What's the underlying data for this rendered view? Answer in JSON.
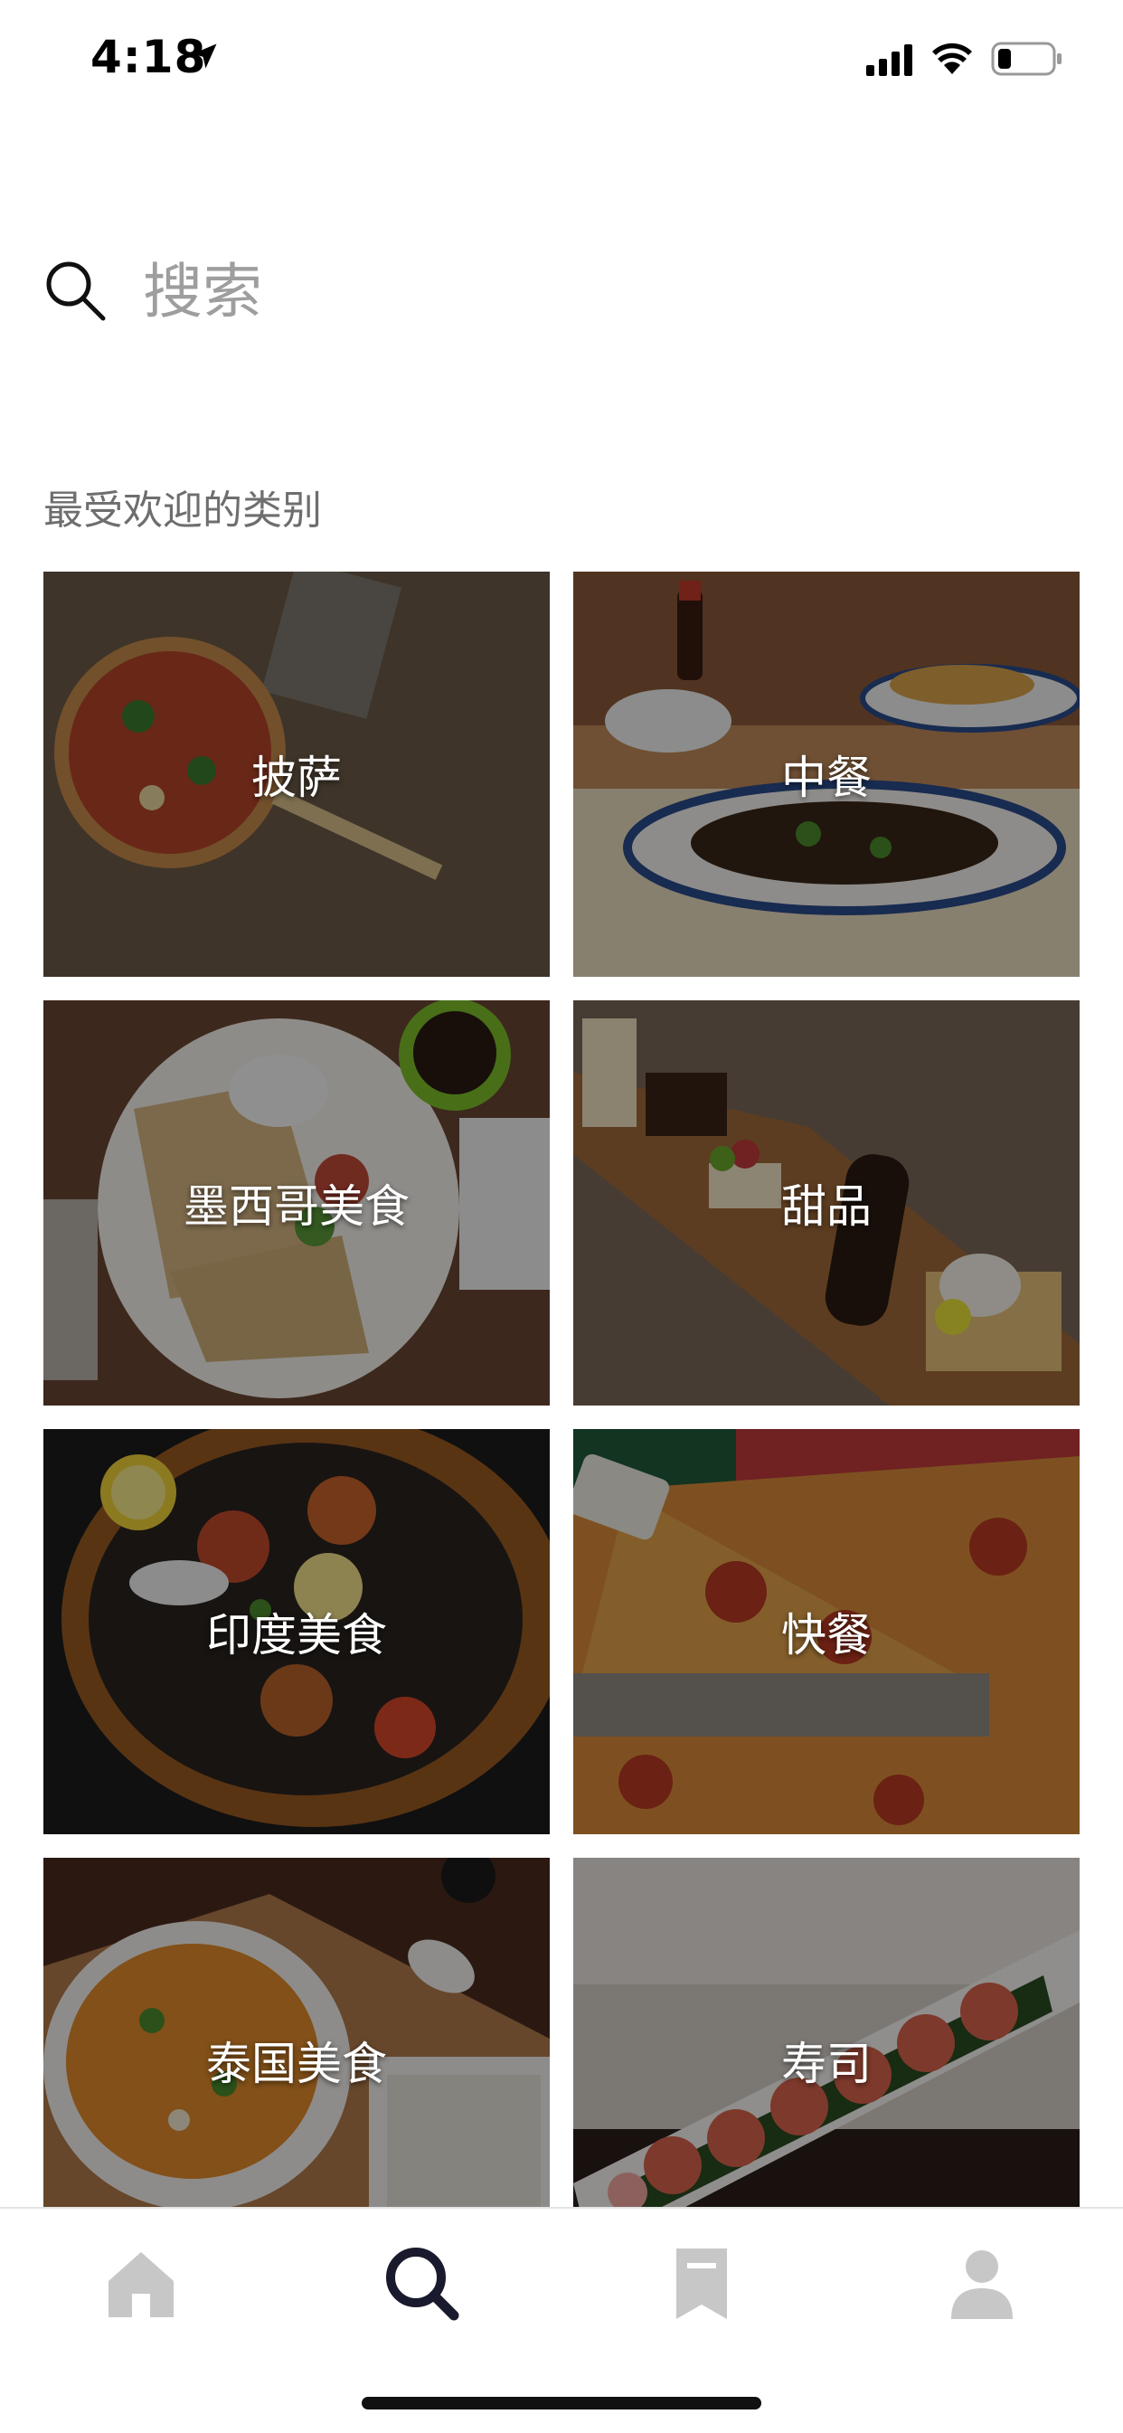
{
  "status_bar": {
    "time": "4:18",
    "icons": [
      "location-arrow-icon",
      "cellular-signal-icon",
      "wifi-icon",
      "battery-icon"
    ]
  },
  "search": {
    "placeholder": "搜索",
    "value": ""
  },
  "section": {
    "title": "最受欢迎的类别"
  },
  "categories": [
    {
      "label": "披萨",
      "image": "pizza photo"
    },
    {
      "label": "中餐",
      "image": "chinese food photo"
    },
    {
      "label": "墨西哥美食",
      "image": "quesadilla photo"
    },
    {
      "label": "甜品",
      "image": "dessert board photo"
    },
    {
      "label": "印度美食",
      "image": "tandoori platter photo"
    },
    {
      "label": "快餐",
      "image": "pepperoni pizza slice photo"
    },
    {
      "label": "泰国美食",
      "image": "thai curry photo"
    },
    {
      "label": "寿司",
      "image": "sushi roll photo"
    }
  ],
  "tab_bar": {
    "tabs": [
      {
        "name": "home",
        "icon": "home-icon",
        "active": false
      },
      {
        "name": "search",
        "icon": "search-icon",
        "active": true
      },
      {
        "name": "orders",
        "icon": "receipt-icon",
        "active": false
      },
      {
        "name": "account",
        "icon": "person-icon",
        "active": false
      }
    ],
    "active_color": "#1a1a2e",
    "inactive_color": "#c7c7c7"
  }
}
